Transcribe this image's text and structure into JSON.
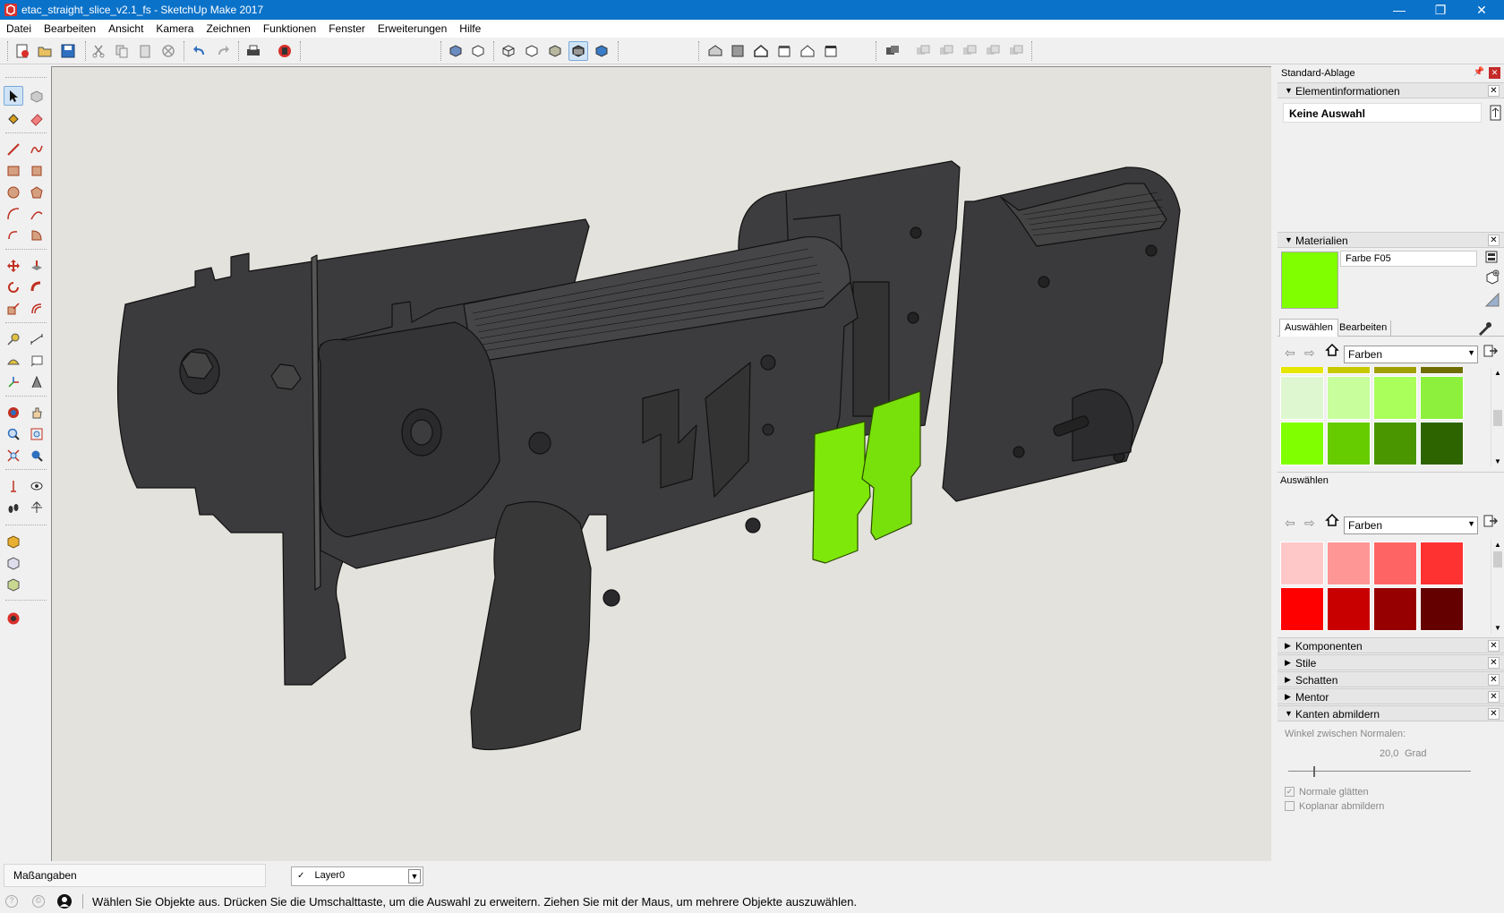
{
  "window": {
    "title": "etac_straight_slice_v2.1_fs - SketchUp Make 2017",
    "minimize": "—",
    "maximize": "❐",
    "close": "✕"
  },
  "menu": [
    "Datei",
    "Bearbeiten",
    "Ansicht",
    "Kamera",
    "Zeichnen",
    "Funktionen",
    "Fenster",
    "Erweiterungen",
    "Hilfe"
  ],
  "tray": {
    "title": "Standard-Ablage",
    "entity_info": {
      "label": "Elementinformationen",
      "selection": "Keine Auswahl"
    },
    "materials": {
      "label": "Materialien",
      "material_name": "Farbe F05",
      "material_color": "#80ff00",
      "tab_select": "Auswählen",
      "tab_edit": "Bearbeiten",
      "library": "Farben",
      "swatches_top": [
        "#e6e600",
        "#c8c800",
        "#a0a000",
        "#6e6e00"
      ],
      "swatches_row1": [
        "#dff7d0",
        "#c8ff9c",
        "#aaff5a",
        "#8cf03c"
      ],
      "swatches_row2": [
        "#80ff00",
        "#66cc00",
        "#4a9600",
        "#2e6400"
      ],
      "swatches_row3": [
        "#c8ffc8",
        "#96ff96",
        "#5aff5a",
        "#1eff3c"
      ]
    },
    "secondary_select": {
      "label": "Auswählen",
      "library": "Farben",
      "swatches_row1": [
        "#ffc8c8",
        "#ff9696",
        "#ff6464",
        "#ff3232"
      ],
      "swatches_row2": [
        "#ff0000",
        "#c80000",
        "#960000",
        "#640000"
      ]
    },
    "collapsed_panels": [
      "Komponenten",
      "Stile",
      "Schatten",
      "Mentor"
    ],
    "soften_edges": {
      "label": "Kanten abmildern",
      "angle_label": "Winkel zwischen Normalen:",
      "angle_value": "20,0",
      "angle_unit": "Grad",
      "smooth_normals": "Normale glätten",
      "soften_coplanar": "Koplanar abmildern"
    }
  },
  "statusbar": {
    "measurements_label": "Maßangaben",
    "layer": "Layer0",
    "hint": "Wählen Sie Objekte aus. Drücken Sie die Umschalttaste, um die Auswahl zu erweitern. Ziehen Sie mit der Maus, um mehrere Objekte auszuwählen."
  }
}
